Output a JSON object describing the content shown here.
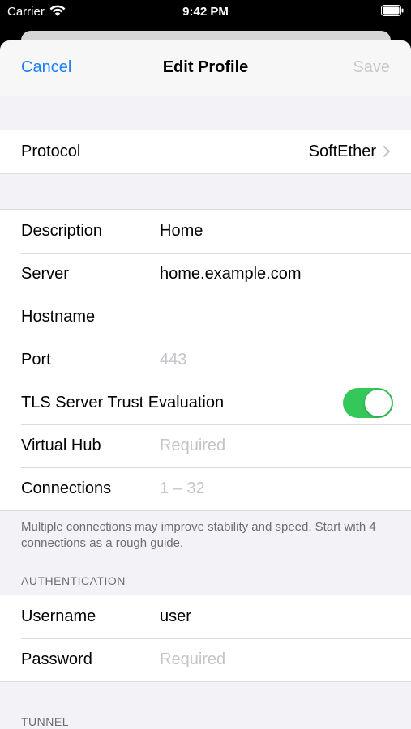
{
  "status_bar": {
    "carrier": "Carrier",
    "time": "9:42 PM"
  },
  "nav": {
    "cancel_label": "Cancel",
    "title": "Edit Profile",
    "save_label": "Save"
  },
  "protocol": {
    "label": "Protocol",
    "value": "SoftEther"
  },
  "connection": {
    "description": {
      "label": "Description",
      "value": "Home"
    },
    "server": {
      "label": "Server",
      "value": "home.example.com"
    },
    "hostname": {
      "label": "Hostname",
      "value": ""
    },
    "port": {
      "label": "Port",
      "placeholder": "443"
    },
    "tls": {
      "label": "TLS Server Trust Evaluation",
      "on": true
    },
    "virtual_hub": {
      "label": "Virtual Hub",
      "placeholder": "Required"
    },
    "connections": {
      "label": "Connections",
      "placeholder": "1 – 32"
    },
    "footer": "Multiple connections may improve stability and speed. Start with 4 connections as a rough guide."
  },
  "authentication": {
    "header": "AUTHENTICATION",
    "username": {
      "label": "Username",
      "value": "user"
    },
    "password": {
      "label": "Password",
      "placeholder": "Required"
    }
  },
  "tunnel": {
    "header": "TUNNEL"
  },
  "colors": {
    "accent": "#1a7ff2",
    "toggle_on": "#34c759",
    "disabled": "#c8c8cc"
  }
}
